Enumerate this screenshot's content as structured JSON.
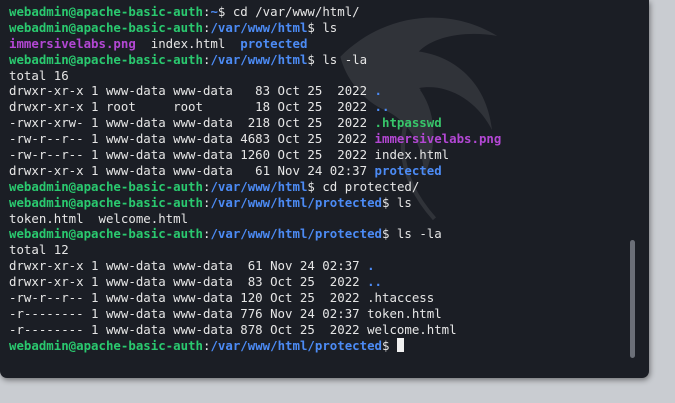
{
  "prompt": {
    "user": "webadmin@apache-basic-auth",
    "sep": ":"
  },
  "lines": [
    {
      "parts": [
        {
          "c": "u",
          "t": "webadmin@apache-basic-auth"
        },
        {
          "c": "",
          "t": ":"
        },
        {
          "c": "p",
          "t": "~"
        },
        {
          "c": "",
          "t": "$ cd /var/www/html/"
        }
      ]
    },
    {
      "parts": [
        {
          "c": "u",
          "t": "webadmin@apache-basic-auth"
        },
        {
          "c": "",
          "t": ":"
        },
        {
          "c": "p",
          "t": "/var/www/html"
        },
        {
          "c": "",
          "t": "$ ls"
        }
      ]
    },
    {
      "parts": [
        {
          "c": "m",
          "t": "immersivelabs.png"
        },
        {
          "c": "",
          "t": "  index.html  "
        },
        {
          "c": "d",
          "t": "protected"
        }
      ]
    },
    {
      "parts": [
        {
          "c": "u",
          "t": "webadmin@apache-basic-auth"
        },
        {
          "c": "",
          "t": ":"
        },
        {
          "c": "p",
          "t": "/var/www/html"
        },
        {
          "c": "",
          "t": "$ ls -la"
        }
      ]
    },
    {
      "parts": [
        {
          "c": "",
          "t": "total 16"
        }
      ]
    },
    {
      "parts": [
        {
          "c": "",
          "t": "drwxr-xr-x 1 www-data www-data   83 Oct 25  2022 "
        },
        {
          "c": "d",
          "t": "."
        }
      ]
    },
    {
      "parts": [
        {
          "c": "",
          "t": "drwxr-xr-x 1 root     root       18 Oct 25  2022 "
        },
        {
          "c": "d",
          "t": ".."
        }
      ]
    },
    {
      "parts": [
        {
          "c": "",
          "t": "-rwxr-xrw- 1 www-data www-data  218 Oct 25  2022 "
        },
        {
          "c": "x",
          "t": ".htpasswd"
        }
      ]
    },
    {
      "parts": [
        {
          "c": "",
          "t": "-rw-r--r-- 1 www-data www-data 4683 Oct 25  2022 "
        },
        {
          "c": "m",
          "t": "immersivelabs.png"
        }
      ]
    },
    {
      "parts": [
        {
          "c": "",
          "t": "-rw-r--r-- 1 www-data www-data 1260 Oct 25  2022 index.html"
        }
      ]
    },
    {
      "parts": [
        {
          "c": "",
          "t": "drwxr-xr-x 1 www-data www-data   61 Nov 24 02:37 "
        },
        {
          "c": "d",
          "t": "protected"
        }
      ]
    },
    {
      "parts": [
        {
          "c": "u",
          "t": "webadmin@apache-basic-auth"
        },
        {
          "c": "",
          "t": ":"
        },
        {
          "c": "p",
          "t": "/var/www/html"
        },
        {
          "c": "",
          "t": "$ cd protected/"
        }
      ]
    },
    {
      "parts": [
        {
          "c": "u",
          "t": "webadmin@apache-basic-auth"
        },
        {
          "c": "",
          "t": ":"
        },
        {
          "c": "p",
          "t": "/var/www/html/protected"
        },
        {
          "c": "",
          "t": "$ ls"
        }
      ]
    },
    {
      "parts": [
        {
          "c": "",
          "t": "token.html  welcome.html"
        }
      ]
    },
    {
      "parts": [
        {
          "c": "u",
          "t": "webadmin@apache-basic-auth"
        },
        {
          "c": "",
          "t": ":"
        },
        {
          "c": "p",
          "t": "/var/www/html/protected"
        },
        {
          "c": "",
          "t": "$ ls -la"
        }
      ]
    },
    {
      "parts": [
        {
          "c": "",
          "t": "total 12"
        }
      ]
    },
    {
      "parts": [
        {
          "c": "",
          "t": "drwxr-xr-x 1 www-data www-data  61 Nov 24 02:37 "
        },
        {
          "c": "d",
          "t": "."
        }
      ]
    },
    {
      "parts": [
        {
          "c": "",
          "t": "drwxr-xr-x 1 www-data www-data  83 Oct 25  2022 "
        },
        {
          "c": "d",
          "t": ".."
        }
      ]
    },
    {
      "parts": [
        {
          "c": "",
          "t": "-rw-r--r-- 1 www-data www-data 120 Oct 25  2022 .htaccess"
        }
      ]
    },
    {
      "parts": [
        {
          "c": "",
          "t": "-r-------- 1 www-data www-data 776 Nov 24 02:37 token.html"
        }
      ]
    },
    {
      "parts": [
        {
          "c": "",
          "t": "-r-------- 1 www-data www-data 878 Oct 25  2022 welcome.html"
        }
      ]
    },
    {
      "parts": [
        {
          "c": "u",
          "t": "webadmin@apache-basic-auth"
        },
        {
          "c": "",
          "t": ":"
        },
        {
          "c": "p",
          "t": "/var/www/html/protected"
        },
        {
          "c": "",
          "t": "$ "
        }
      ],
      "cursor": true
    }
  ],
  "colors": {
    "background": "#1b1e25",
    "prompt_user": "#2ac96f",
    "prompt_path": "#4c8bf5",
    "directory": "#4c8bf5",
    "executable": "#37c66a",
    "image_file": "#b347d4",
    "text": "#e6e6e6"
  },
  "icons": {
    "background_logo": "kali-dragon-icon"
  }
}
